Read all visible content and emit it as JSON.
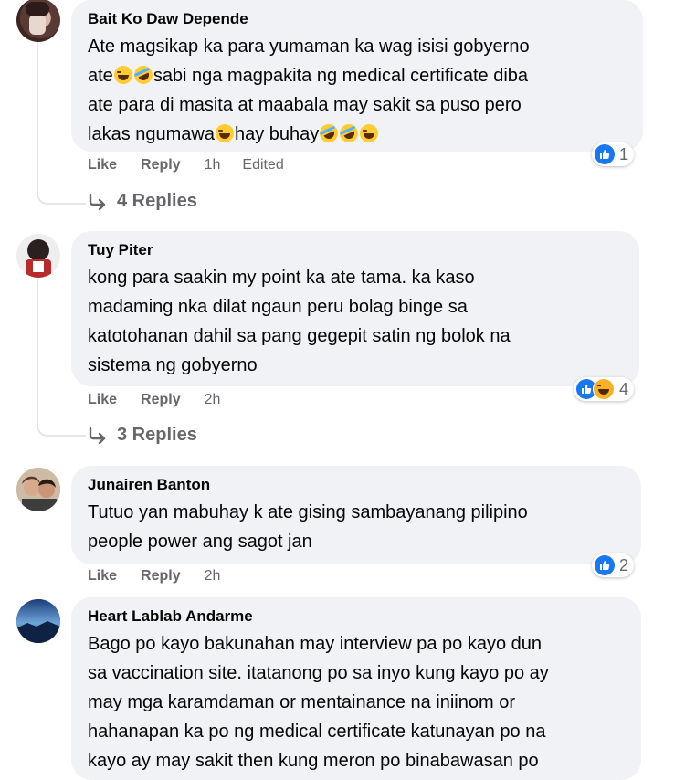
{
  "comments": [
    {
      "author": "Bait Ko Daw Depende",
      "lines": [
        "Ate magsikap ka para yumaman ka wag isisi gobyerno",
        "sabi nga magpakita ng medical certificate diba",
        "ate para di masita at maabala may sakit sa puso pero",
        "hay buhay"
      ],
      "line1_tail": "ate",
      "line4_head": "lakas ngumawa",
      "like": "Like",
      "reply": "Reply",
      "time": "1h",
      "edited": "Edited",
      "reaction_count": "1",
      "replies_label": "4 Replies"
    },
    {
      "author": "Tuy Piter",
      "lines": [
        "kong para saakin my point ka ate tama. ka kaso",
        "madaming nka dilat ngaun peru bolag binge sa",
        "katotohanan dahil sa pang gegepit satin ng bolok na",
        "sistema ng gobyerno"
      ],
      "like": "Like",
      "reply": "Reply",
      "time": "2h",
      "reaction_count": "4",
      "replies_label": "3 Replies"
    },
    {
      "author": "Junairen Banton",
      "lines": [
        "Tutuo yan mabuhay k ate gising sambayanang pilipino",
        "people power ang sagot jan"
      ],
      "like": "Like",
      "reply": "Reply",
      "time": "2h",
      "reaction_count": "2"
    },
    {
      "author": "Heart Lablab Andarme",
      "lines": [
        "Bago po kayo bakunahan may interview pa po kayo dun",
        "sa vaccination site. itatanong po sa inyo kung kayo po ay",
        "may mga karamdaman or mentainance na iniinom or",
        "hahanapan ka po ng medical certificate katunayan po na",
        "kayo ay may sakit then kung meron po binabawasan po"
      ]
    }
  ],
  "icons": {
    "like_reaction": "like-icon",
    "haha_reaction": "haha-icon",
    "reply_arrow": "reply-arrow-icon",
    "grin_emoji": "grinning-sweat-emoji-icon",
    "rofl_emoji": "rofl-emoji-icon"
  },
  "colors": {
    "bubble": "#f0f2f5",
    "meta_text": "#65676b",
    "like_blue": "#1877f2",
    "haha_yellow": "#f7b125"
  }
}
